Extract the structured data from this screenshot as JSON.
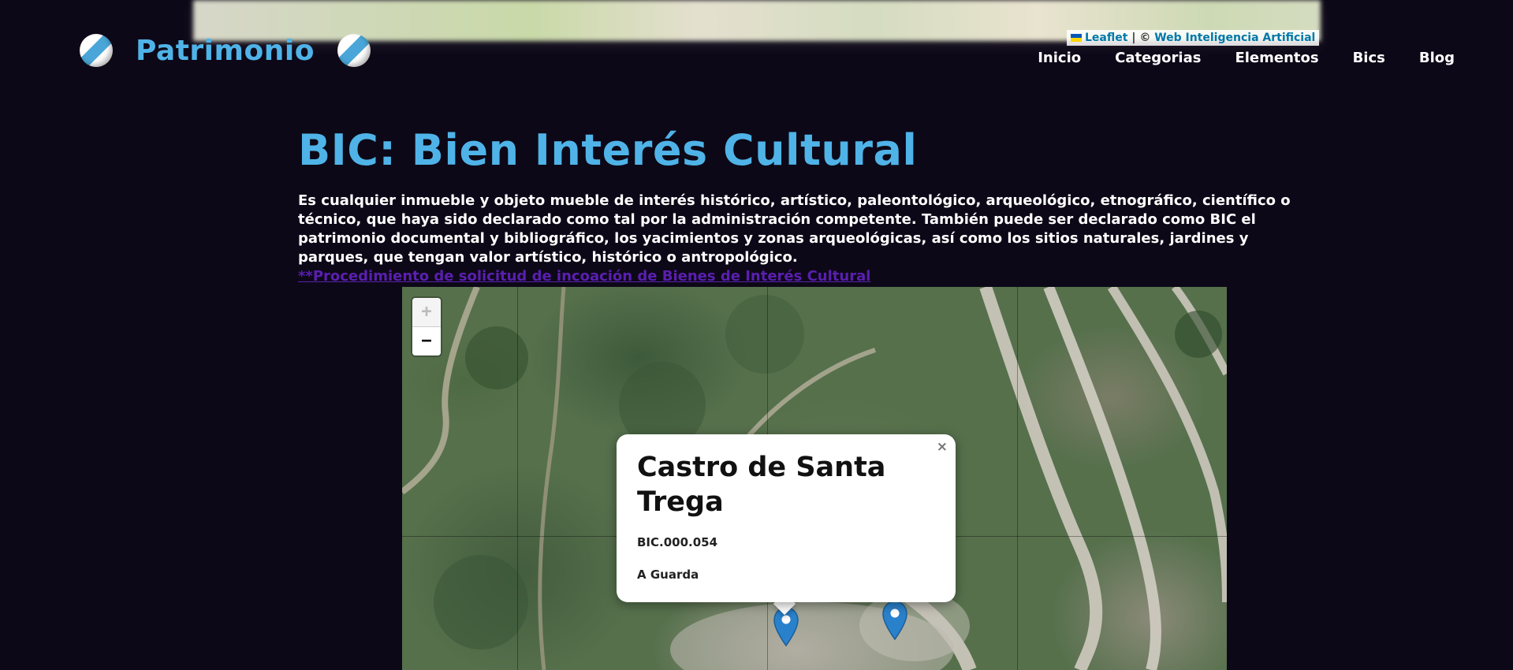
{
  "top_attribution": {
    "leaflet_label": "Leaflet",
    "separator": "|",
    "copyright_symbol": "©",
    "provider_label": "Web Inteligencia Artificial"
  },
  "header": {
    "brand_title": "Patrimonio",
    "nav": [
      "Inicio",
      "Categorias",
      "Elementos",
      "Bics",
      "Blog"
    ]
  },
  "main": {
    "title": "BIC: Bien Interés Cultural",
    "description": "Es cualquier inmueble y objeto mueble de interés histórico, artístico, paleontológico, arqueológico, etnográfico, científico o técnico, que haya sido declarado como tal por la administración competente. También puede ser declarado como BIC el patrimonio documental y bibliográfico, los yacimientos y zonas arqueológicas, así como los sitios naturales, jardines y parques, que tengan valor artístico, histórico o antropológico.",
    "procedure_link": "**Procedimiento de solicitud de incoación de Bienes de Interés Cultural"
  },
  "map": {
    "zoom_in": "+",
    "zoom_out": "−",
    "popup": {
      "close": "×",
      "title": "Castro de Santa Trega",
      "code": "BIC.000.054",
      "place": "A Guarda"
    }
  },
  "colors": {
    "background": "#0d0817",
    "accent": "#4fb3e8",
    "link": "#5a1fb0",
    "marker": "#2a81cb"
  }
}
